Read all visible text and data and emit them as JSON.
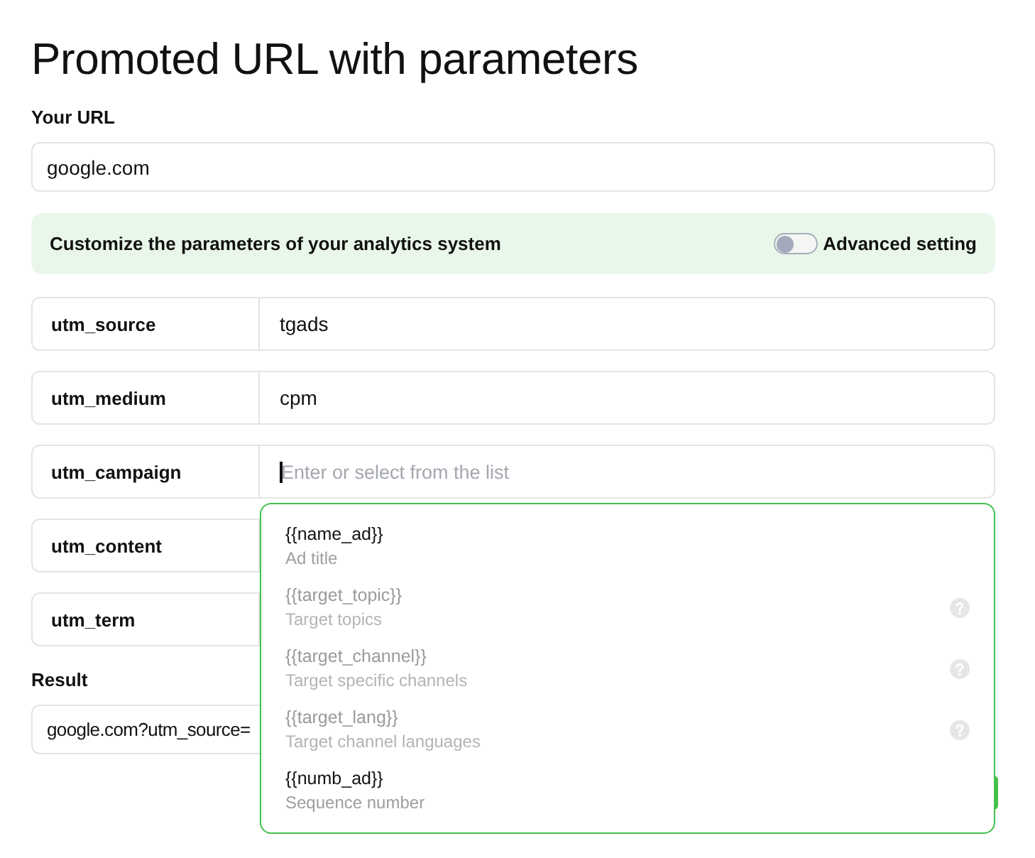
{
  "page": {
    "title": "Promoted URL with parameters"
  },
  "url": {
    "label": "Your URL",
    "value": "google.com"
  },
  "banner": {
    "text": "Customize the parameters of your analytics system",
    "toggle": {
      "label": "Advanced setting",
      "on": false
    }
  },
  "params": [
    {
      "name": "utm_source",
      "value": "tgads",
      "focused": false
    },
    {
      "name": "utm_medium",
      "value": "cpm",
      "focused": false
    },
    {
      "name": "utm_campaign",
      "placeholder": "Enter or select from the list",
      "focused": true
    },
    {
      "name": "utm_content",
      "focused": false
    },
    {
      "name": "utm_term",
      "focused": false
    }
  ],
  "dropdown": {
    "items": [
      {
        "token": "{{name_ad}}",
        "description": "Ad title",
        "disabled": false
      },
      {
        "token": "{{target_topic}}",
        "description": "Target topics",
        "disabled": true
      },
      {
        "token": "{{target_channel}}",
        "description": "Target specific channels",
        "disabled": true
      },
      {
        "token": "{{target_lang}}",
        "description": "Target channel languages",
        "disabled": true
      },
      {
        "token": "{{numb_ad}}",
        "description": "Sequence number",
        "disabled": false
      }
    ]
  },
  "result": {
    "label": "Result",
    "value": "google.com?utm_source="
  }
}
